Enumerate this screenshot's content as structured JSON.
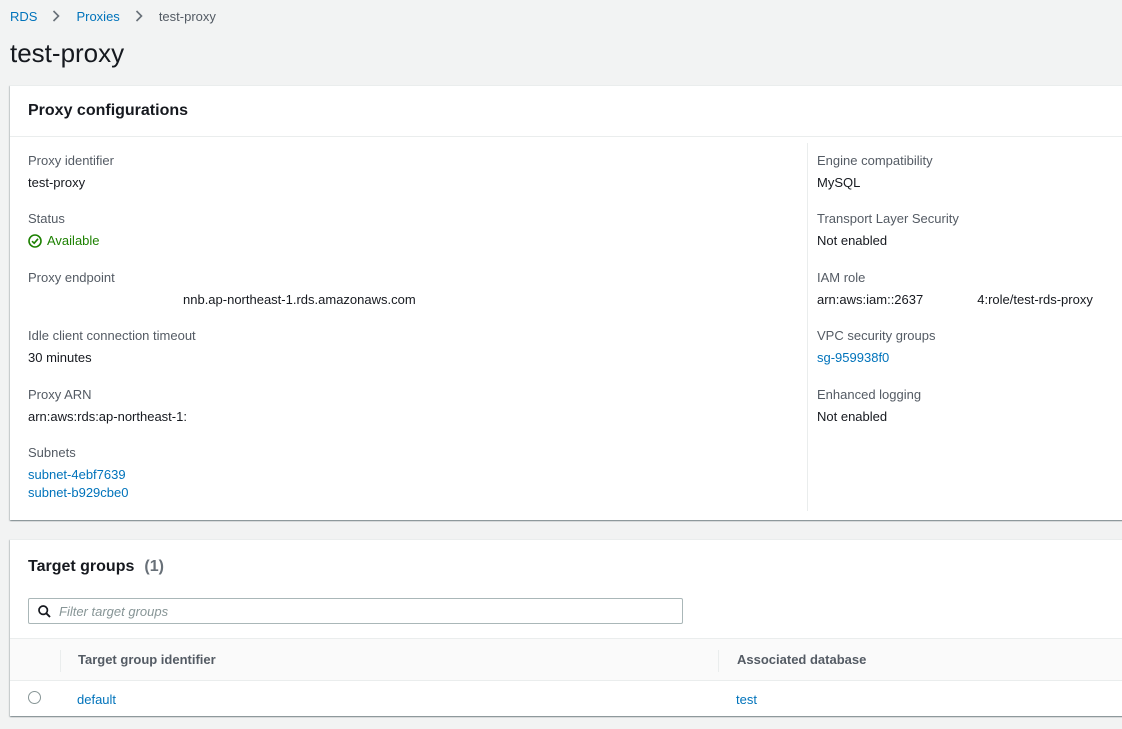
{
  "breadcrumb": {
    "items": [
      "RDS",
      "Proxies"
    ],
    "current": "test-proxy"
  },
  "page": {
    "title": "test-proxy"
  },
  "config": {
    "title": "Proxy configurations",
    "left": {
      "proxy_identifier": {
        "label": "Proxy identifier",
        "value": "test-proxy"
      },
      "status": {
        "label": "Status",
        "value": "Available"
      },
      "proxy_endpoint": {
        "label": "Proxy endpoint",
        "value": "nnb.ap-northeast-1.rds.amazonaws.com"
      },
      "idle_timeout": {
        "label": "Idle client connection timeout",
        "value": "30 minutes"
      },
      "proxy_arn": {
        "label": "Proxy ARN",
        "value": "arn:aws:rds:ap-northeast-1:"
      },
      "subnets": {
        "label": "Subnets",
        "values": [
          "subnet-4ebf7639",
          "subnet-b929cbe0"
        ]
      }
    },
    "right": {
      "engine": {
        "label": "Engine compatibility",
        "value": "MySQL"
      },
      "tls": {
        "label": "Transport Layer Security",
        "value": "Not enabled"
      },
      "iam_role": {
        "label": "IAM role",
        "value_a": "arn:aws:iam::2637",
        "value_b": "4:role/test-rds-proxy"
      },
      "vpc_sg": {
        "label": "VPC security groups",
        "value": "sg-959938f0"
      },
      "logging": {
        "label": "Enhanced logging",
        "value": "Not enabled"
      }
    }
  },
  "targets": {
    "title": "Target groups",
    "count": "(1)",
    "filter_placeholder": "Filter target groups",
    "columns": [
      "Target group identifier",
      "Associated database"
    ],
    "rows": [
      {
        "identifier": "default",
        "database": "test"
      }
    ]
  },
  "colors": {
    "link": "#0073bb",
    "success": "#1d8102",
    "background": "#f2f3f3"
  }
}
